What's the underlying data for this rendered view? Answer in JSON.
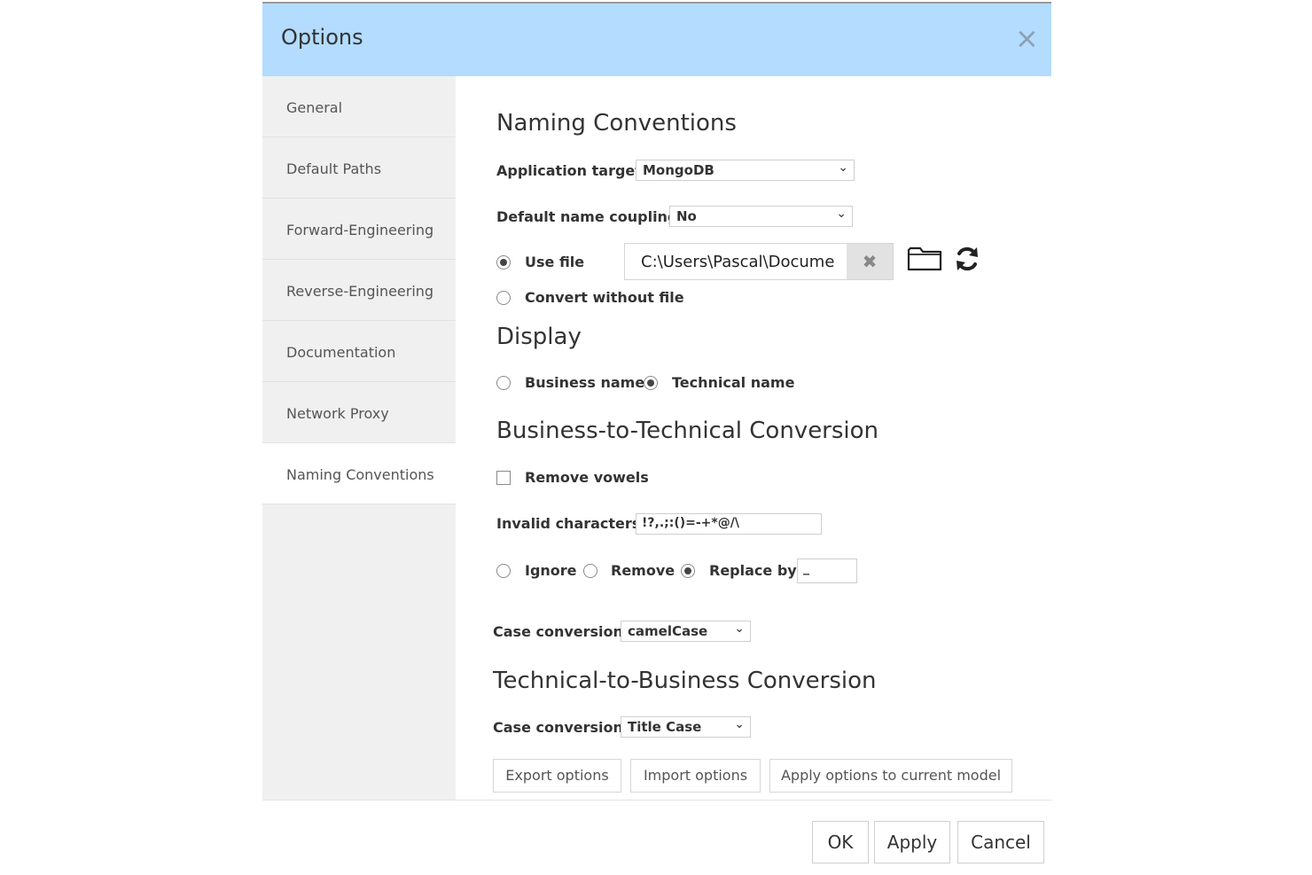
{
  "dialog": {
    "title": "Options",
    "close_symbol": "×"
  },
  "sidebar": {
    "items": [
      {
        "label": "General"
      },
      {
        "label": "Default Paths"
      },
      {
        "label": "Forward-Engineering"
      },
      {
        "label": "Reverse-Engineering"
      },
      {
        "label": "Documentation"
      },
      {
        "label": "Network Proxy"
      },
      {
        "label": "Naming Conventions"
      }
    ],
    "active": "Naming Conventions"
  },
  "naming": {
    "heading": "Naming Conventions",
    "app_target_label": "Application target",
    "app_target_value": "MongoDB",
    "coupling_label": "Default name coupling",
    "coupling_value": "No",
    "use_file_label": "Use file",
    "file_path": "C:\\Users\\Pascal\\Documents",
    "convert_label": "Convert without file"
  },
  "display": {
    "heading": "Display",
    "business_label": "Business name",
    "technical_label": "Technical name"
  },
  "b2t": {
    "heading": "Business-to-Technical Conversion",
    "remove_vowels_label": "Remove vowels",
    "invalid_label": "Invalid characters",
    "invalid_value": "!?,.;:()=-+*@/\\",
    "ignore_label": "Ignore",
    "remove_label": "Remove",
    "replace_label": "Replace by",
    "replace_value": "_",
    "case_label": "Case conversion",
    "case_value": "camelCase"
  },
  "t2b": {
    "heading": "Technical-to-Business Conversion",
    "case_label": "Case conversion",
    "case_value": "Title Case"
  },
  "actions": {
    "export_label": "Export options",
    "import_label": "Import options",
    "apply_model_label": "Apply options to current model"
  },
  "footer": {
    "ok_label": "OK",
    "apply_label": "Apply",
    "cancel_label": "Cancel"
  },
  "icons": {
    "close": "close-icon",
    "clear": "clear-icon",
    "folder": "folder-icon",
    "refresh": "refresh-icon",
    "chevron": "chevron-down-icon"
  },
  "colors": {
    "titlebar": "#b3dcff",
    "sidebar": "#f0f0f0"
  }
}
